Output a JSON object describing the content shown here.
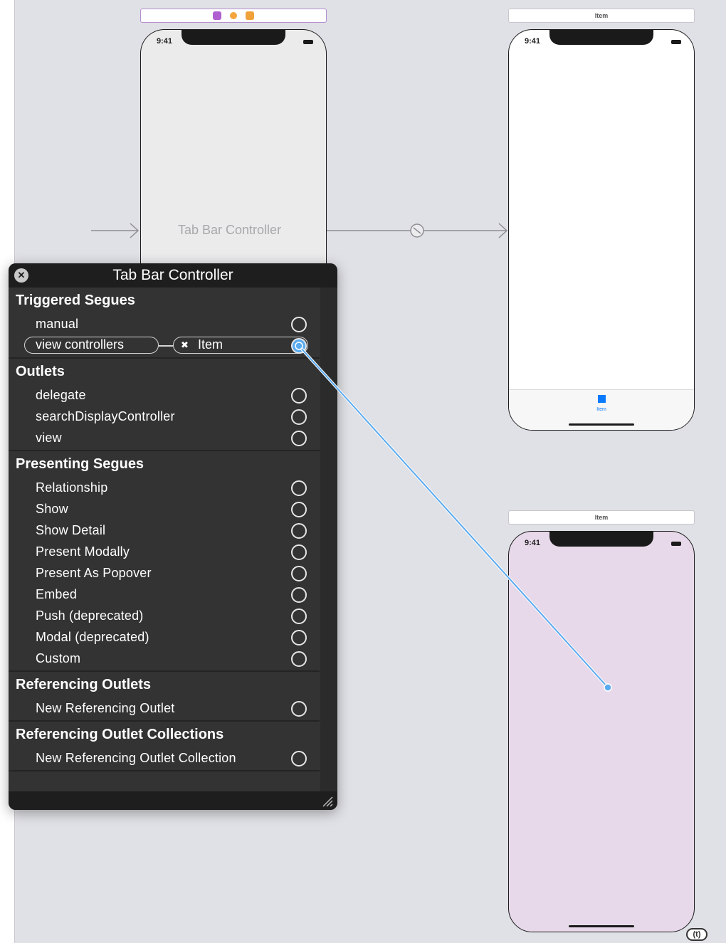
{
  "canvas": {
    "tab_bar_scene_label": "Tab Bar Controller",
    "item_scene_1_dock_title": "Item",
    "item_scene_2_dock_title": "Item",
    "status_time": "9:41",
    "tab_item_label": "Item",
    "bottom_badge": "(t)"
  },
  "hud": {
    "title": "Tab Bar Controller",
    "close_glyph": "✕",
    "sections": {
      "triggered_segues": {
        "title": "Triggered Segues",
        "rows": [
          "manual"
        ],
        "view_controllers_label": "view controllers",
        "connected_item_label": "Item",
        "disconnect_glyph": "✖"
      },
      "outlets": {
        "title": "Outlets",
        "rows": [
          "delegate",
          "searchDisplayController",
          "view"
        ]
      },
      "presenting_segues": {
        "title": "Presenting Segues",
        "rows": [
          "Relationship",
          "Show",
          "Show Detail",
          "Present Modally",
          "Present As Popover",
          "Embed",
          "Push (deprecated)",
          "Modal (deprecated)",
          "Custom"
        ]
      },
      "referencing_outlets": {
        "title": "Referencing Outlets",
        "rows": [
          "New Referencing Outlet"
        ]
      },
      "referencing_outlet_collections": {
        "title": "Referencing Outlet Collections",
        "rows": [
          "New Referencing Outlet Collection"
        ]
      }
    }
  },
  "colors": {
    "canvas_bg": "#e0e1e6",
    "hud_bg": "#333333",
    "connection_line": "#5aaaf0",
    "tab_accent": "#0a7aff",
    "item_scene_2_bg": "#e8d9ea"
  }
}
